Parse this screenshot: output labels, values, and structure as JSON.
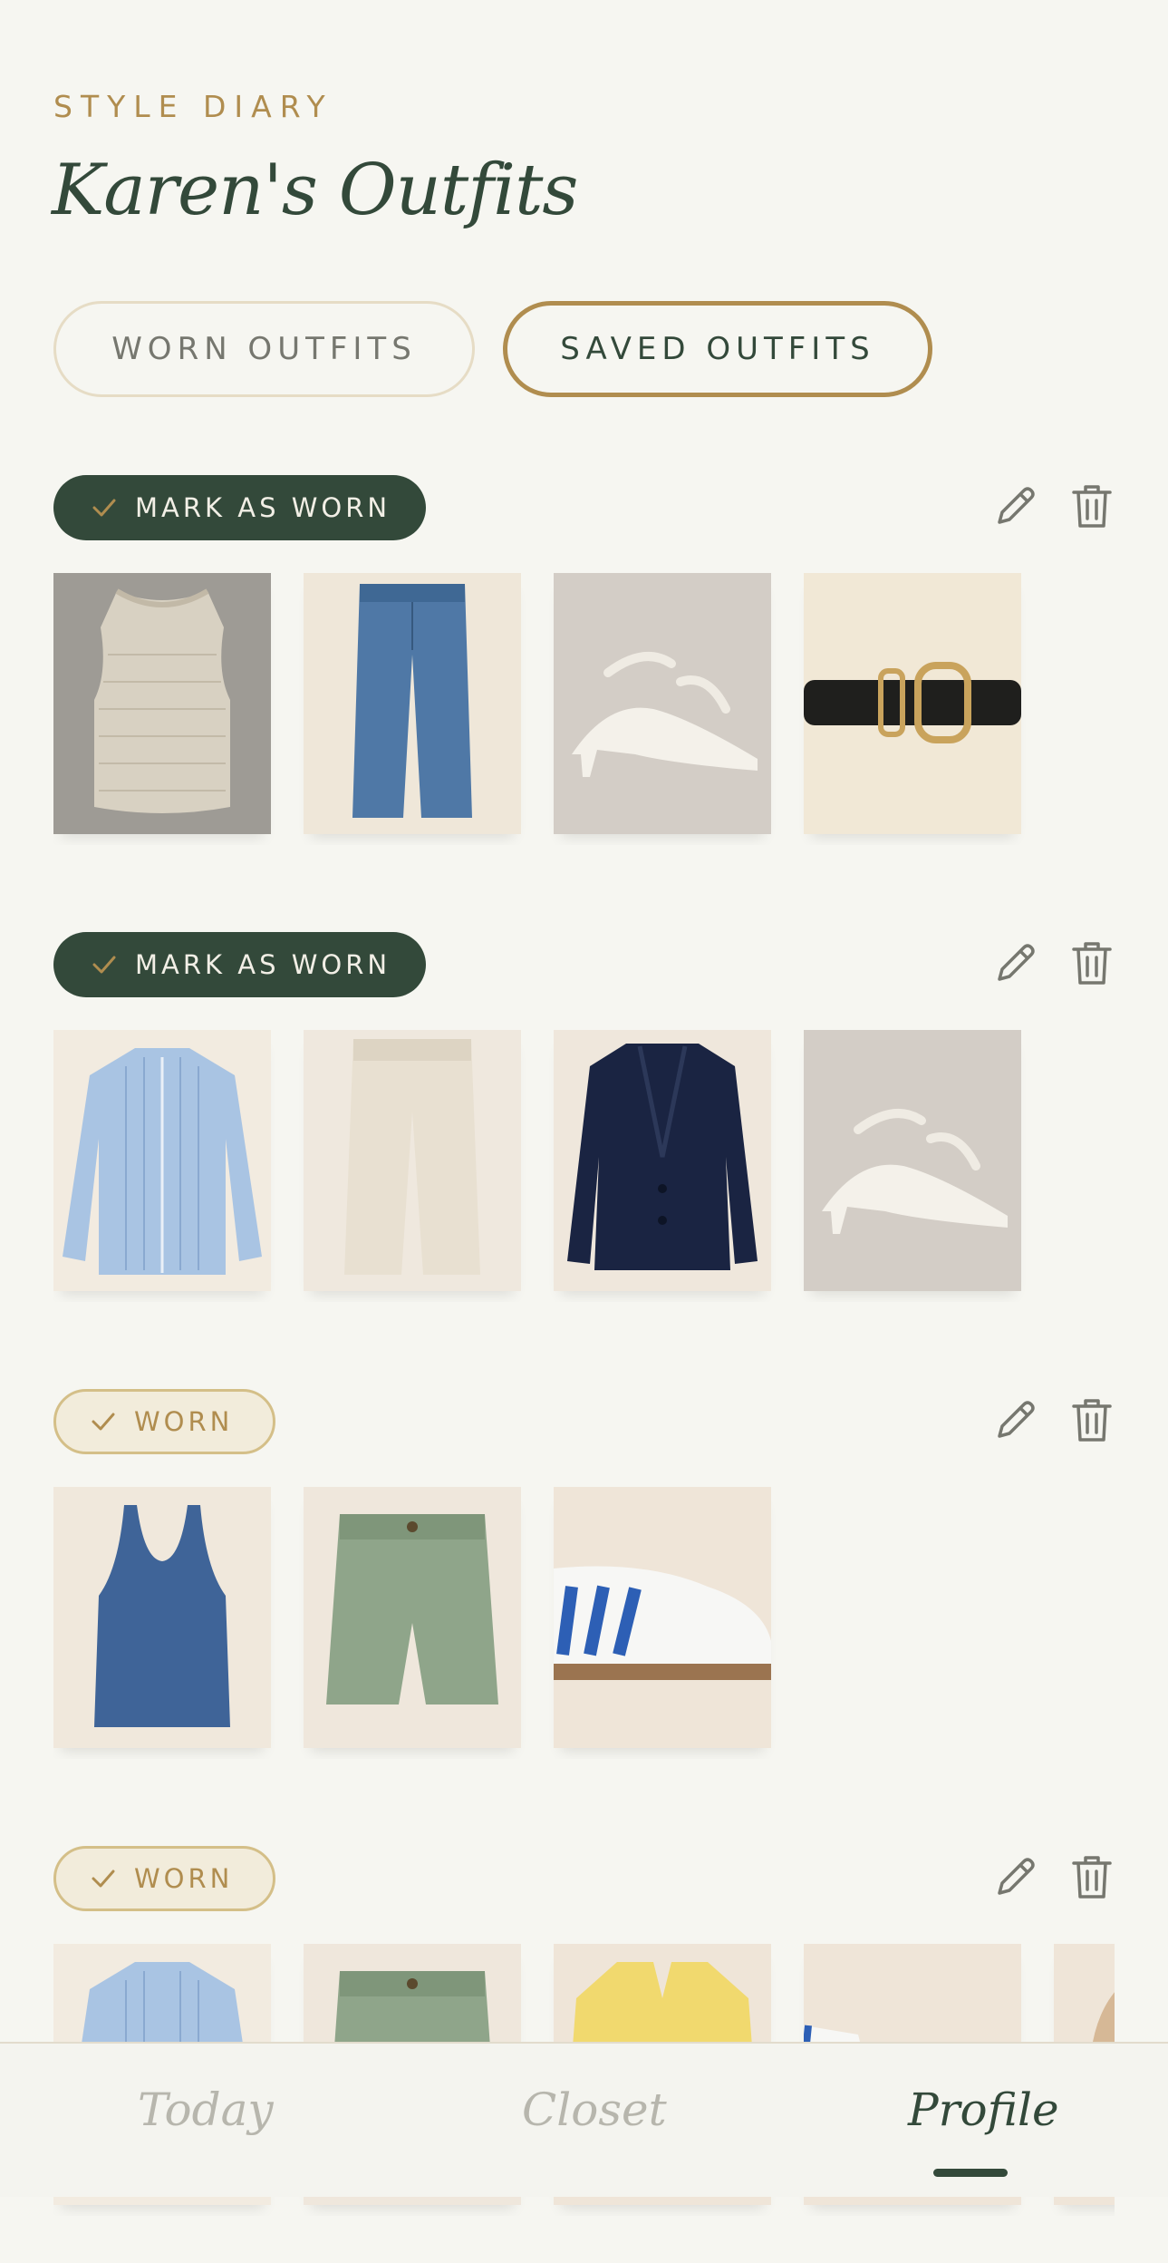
{
  "header": {
    "kicker": "STYLE DIARY",
    "title": "Karen's Outfits"
  },
  "tabs": [
    {
      "label": "WORN OUTFITS",
      "active": false
    },
    {
      "label": "SAVED OUTFITS",
      "active": true
    }
  ],
  "outfits": [
    {
      "status": "MARK AS WORN",
      "items": [
        "sweater-vest",
        "jeans",
        "white-heeled-sandals",
        "black-belt"
      ]
    },
    {
      "status": "MARK AS WORN",
      "items": [
        "blue-striped-shirt",
        "cream-trousers",
        "navy-blazer",
        "white-heeled-sandals"
      ]
    },
    {
      "status": "WORN",
      "items": [
        "blue-tank-top",
        "green-shorts",
        "white-blue-sneakers"
      ]
    },
    {
      "status": "WORN",
      "items": [
        "blue-striped-shirt",
        "green-shorts",
        "yellow-cardigan",
        "white-blue-sneakers",
        "tan-item"
      ]
    }
  ],
  "nav": {
    "today": "Today",
    "closet": "Closet",
    "profile": "Profile",
    "active": "Profile"
  },
  "colors": {
    "background": "#f6f6f1",
    "primary_green": "#33493a",
    "gold_accent": "#b08d4f",
    "muted_text": "#76776f"
  },
  "icons": [
    "check-icon",
    "pencil-icon",
    "trash-icon"
  ]
}
